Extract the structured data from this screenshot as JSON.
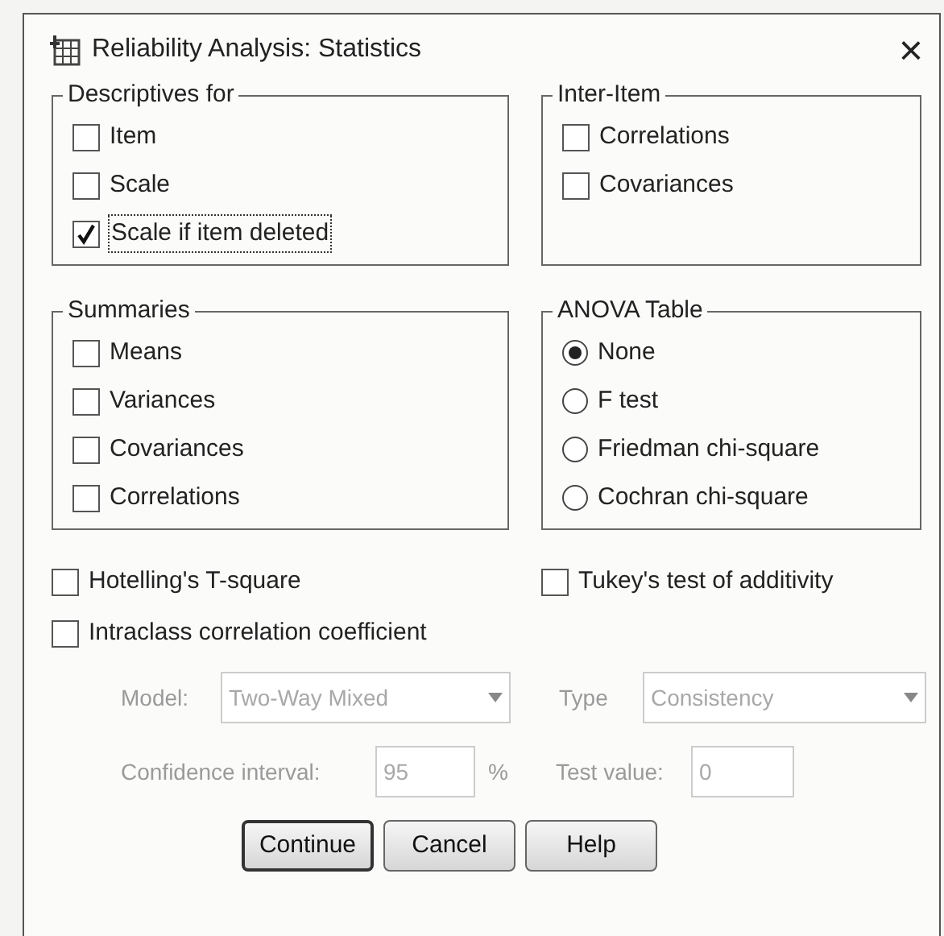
{
  "window": {
    "title": "Reliability Analysis: Statistics",
    "close": "×"
  },
  "groups": [
    {
      "title": "Descriptives for",
      "kind": "checks",
      "items": [
        {
          "label": "Item",
          "checked": false,
          "focused": false
        },
        {
          "label": "Scale",
          "checked": false,
          "focused": false
        },
        {
          "label": "Scale if item deleted",
          "checked": true,
          "focused": true
        }
      ]
    },
    {
      "title": "Inter-Item",
      "kind": "checks",
      "items": [
        {
          "label": "Correlations",
          "checked": false,
          "focused": false
        },
        {
          "label": "Covariances",
          "checked": false,
          "focused": false
        }
      ]
    },
    {
      "title": "Summaries",
      "kind": "checks",
      "items": [
        {
          "label": "Means",
          "checked": false,
          "focused": false
        },
        {
          "label": "Variances",
          "checked": false,
          "focused": false
        },
        {
          "label": "Covariances",
          "checked": false,
          "focused": false
        },
        {
          "label": "Correlations",
          "checked": false,
          "focused": false
        }
      ]
    },
    {
      "title": "ANOVA Table",
      "kind": "radios",
      "items": [
        {
          "label": "None",
          "selected": true
        },
        {
          "label": "F test",
          "selected": false
        },
        {
          "label": "Friedman chi-square",
          "selected": false
        },
        {
          "label": "Cochran chi-square",
          "selected": false
        }
      ]
    }
  ],
  "extra_checks": [
    {
      "label": "Hotelling's T-square",
      "checked": false
    },
    {
      "label": "Tukey's test of additivity",
      "checked": false
    },
    {
      "label": "Intraclass correlation coefficient",
      "checked": false
    }
  ],
  "icc": {
    "disabled": true,
    "model": {
      "label": "Model:",
      "value": "Two-Way Mixed"
    },
    "type": {
      "label": "Type",
      "value": "Consistency"
    },
    "confidence": {
      "label": "Confidence interval:",
      "value": "95",
      "unit": "%"
    },
    "test_value": {
      "label": "Test value:",
      "value": "0"
    }
  },
  "buttons": [
    {
      "label": "Continue",
      "default": true
    },
    {
      "label": "Cancel",
      "default": false
    },
    {
      "label": "Help",
      "default": false
    }
  ]
}
